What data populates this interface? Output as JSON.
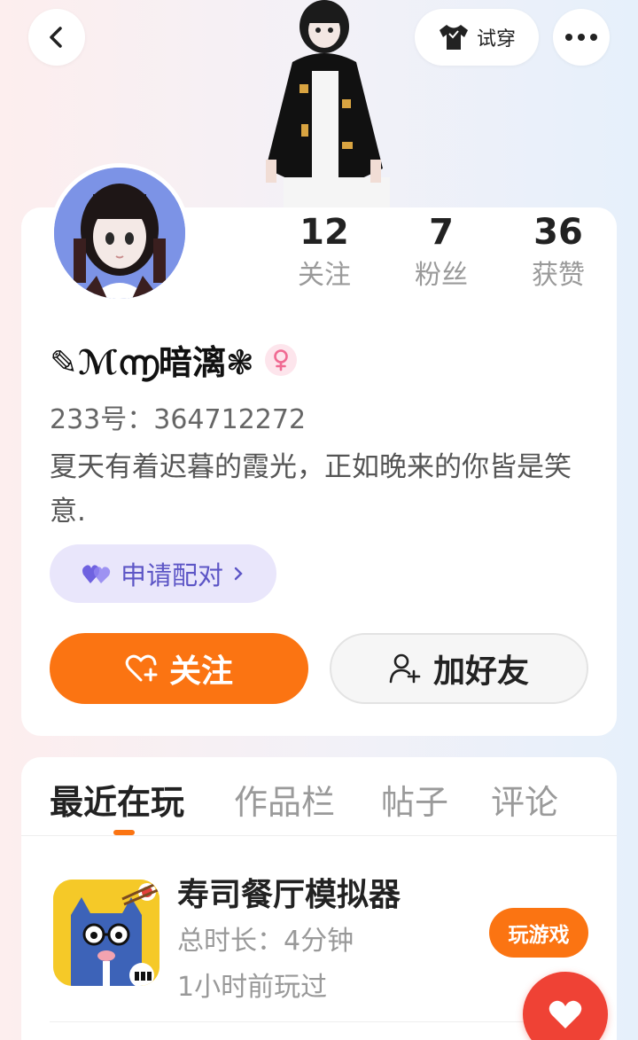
{
  "header": {
    "tryon_label": "试穿",
    "back_icon": "chevron-left-icon",
    "more_icon": "more-dots-icon",
    "tryon_icon": "tshirt-icon"
  },
  "profile": {
    "stats": [
      {
        "value": "12",
        "label": "关注"
      },
      {
        "value": "7",
        "label": "粉丝"
      },
      {
        "value": "36",
        "label": "获赞"
      }
    ],
    "nickname": "✎ℳ൬暗漓❃",
    "gender_icon": "female-icon",
    "uid": "233号：364712272",
    "bio": "夏天有着迟暮的霞光，正如晚来的你皆是笑意.",
    "pair_label": "申请配对",
    "follow_label": "关注",
    "add_friend_label": "加好友"
  },
  "tabs": [
    "最近在玩",
    "作品栏",
    "帖子",
    "评论"
  ],
  "recent_games": [
    {
      "title": "寿司餐厅模拟器",
      "duration": "总时长：4分钟",
      "last_played": "1小时前玩过",
      "play_label": "玩游戏"
    }
  ],
  "colors": {
    "accent": "#fb7412",
    "pair_bg": "#e9e6fb",
    "pair_text": "#5d56c6",
    "fab": "#ef4235"
  }
}
